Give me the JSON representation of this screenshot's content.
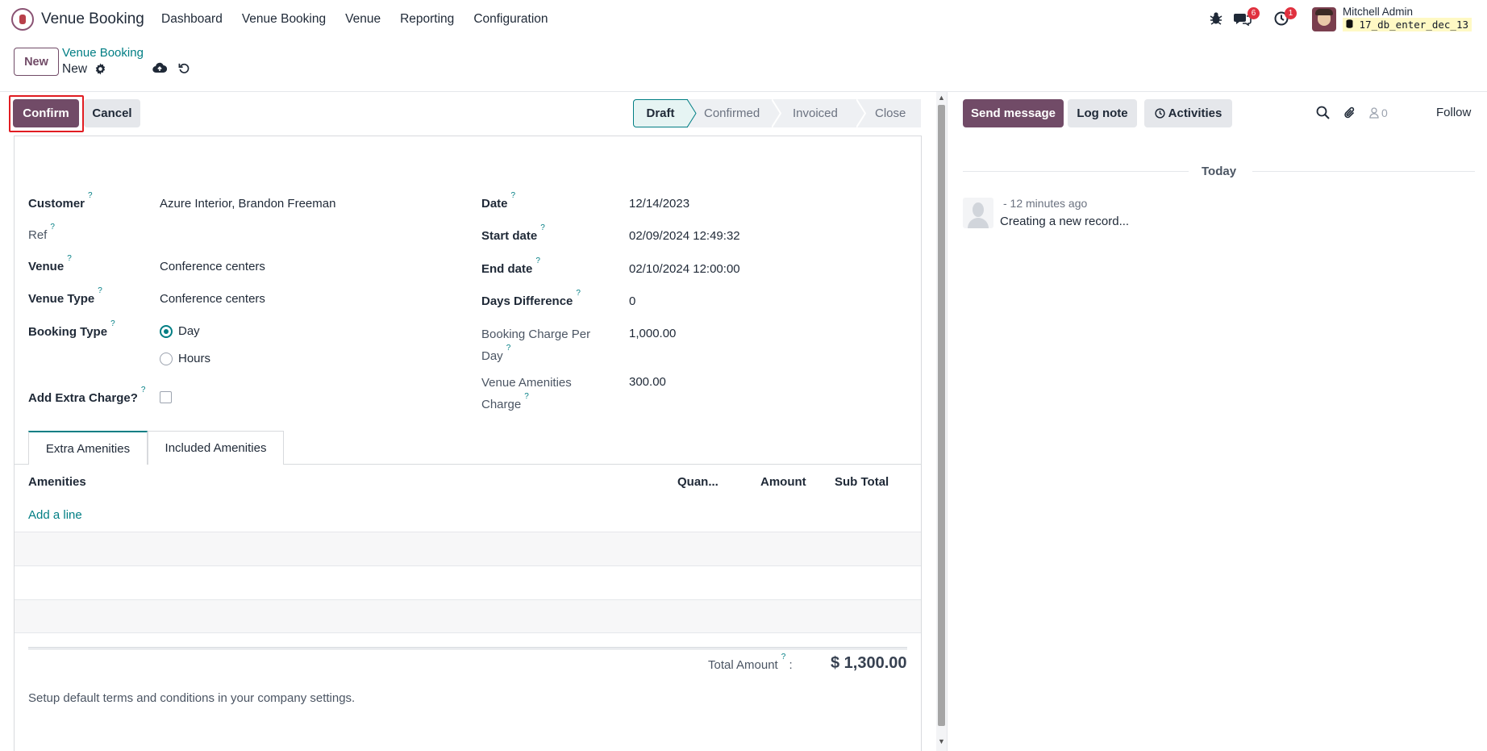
{
  "navbar": {
    "app_name": "Venue Booking",
    "menu": [
      "Dashboard",
      "Venue Booking",
      "Venue",
      "Reporting",
      "Configuration"
    ],
    "messages_count": "6",
    "activities_count": "1",
    "user_name": "Mitchell Admin",
    "database": "17_db_enter_dec_13"
  },
  "control_panel": {
    "new_label": "New",
    "breadcrumb_parent": "Venue Booking",
    "breadcrumb_current": "New"
  },
  "form": {
    "confirm_label": "Confirm",
    "cancel_label": "Cancel",
    "stages": [
      "Draft",
      "Confirmed",
      "Invoiced",
      "Close"
    ],
    "active_stage": "Draft",
    "help_mark": "?",
    "left": {
      "customer_label": "Customer",
      "customer_value": "Azure Interior, Brandon Freeman",
      "ref_label": "Ref",
      "venue_label": "Venue",
      "venue_value": "Conference centers",
      "venue_type_label": "Venue Type",
      "venue_type_value": "Conference centers",
      "booking_type_label": "Booking Type",
      "booking_type_options": [
        "Day",
        "Hours"
      ],
      "booking_type_selected": "Day",
      "extra_charge_label": "Add Extra Charge?"
    },
    "right": {
      "date_label": "Date",
      "date_value": "12/14/2023",
      "start_label": "Start date",
      "start_value": "02/09/2024 12:49:32",
      "end_label": "End date",
      "end_value": "02/10/2024 12:00:00",
      "days_label": "Days Difference",
      "days_value": "0",
      "charge_label": "Booking Charge Per Day",
      "charge_value": "1,000.00",
      "amenities_label": "Venue Amenities Charge",
      "amenities_value": "300.00"
    },
    "tabs": [
      "Extra Amenities",
      "Included Amenities"
    ],
    "table": {
      "headers": [
        "Amenities",
        "Quan...",
        "Amount",
        "Sub Total"
      ],
      "add_line": "Add a line"
    },
    "total_label": "Total Amount",
    "total_value": "$ 1,300.00",
    "terms": "Setup default terms and conditions in your company settings."
  },
  "chatter": {
    "send_message": "Send message",
    "log_note": "Log note",
    "activities": "Activities",
    "followers_count": "0",
    "follow": "Follow",
    "today": "Today",
    "message_time": "- 12 minutes ago",
    "message_body": "Creating a new record..."
  },
  "colors": {
    "brand": "#714b67",
    "accent": "#017e84",
    "highlight": "#e11d22"
  }
}
